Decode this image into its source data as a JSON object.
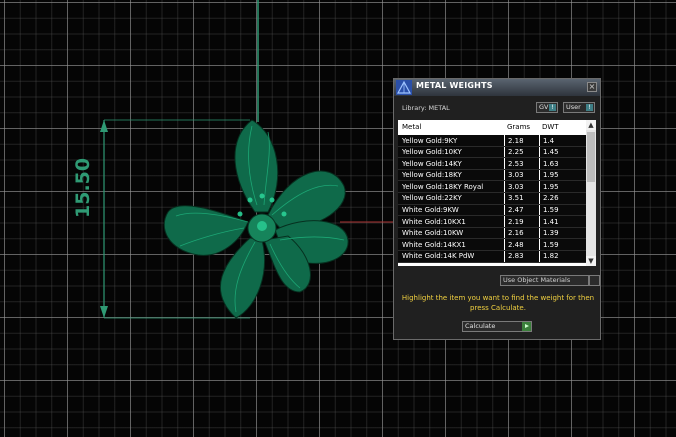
{
  "viewport": {
    "dimension_label": "15.50",
    "accent_color": "#2f9a74"
  },
  "panel": {
    "title": "METAL WEIGHTS",
    "close_glyph": "×",
    "library_label": "Library: METAL",
    "gv_label": "GV",
    "user_label": "User",
    "indicator_glyph": "!",
    "columns": [
      "Metal",
      "Grams",
      "DWT"
    ],
    "rows": [
      {
        "metal": "Yellow Gold:9KY",
        "grams": "2.18",
        "dwt": "1.4"
      },
      {
        "metal": "Yellow Gold:10KY",
        "grams": "2.25",
        "dwt": "1.45"
      },
      {
        "metal": "Yellow Gold:14KY",
        "grams": "2.53",
        "dwt": "1.63"
      },
      {
        "metal": "Yellow Gold:18KY",
        "grams": "3.03",
        "dwt": "1.95"
      },
      {
        "metal": "Yellow Gold:18KY Royal",
        "grams": "3.03",
        "dwt": "1.95"
      },
      {
        "metal": "Yellow Gold:22KY",
        "grams": "3.51",
        "dwt": "2.26"
      },
      {
        "metal": "White Gold:9KW",
        "grams": "2.47",
        "dwt": "1.59"
      },
      {
        "metal": "White Gold:10KX1",
        "grams": "2.19",
        "dwt": "1.41"
      },
      {
        "metal": "White Gold:10KW",
        "grams": "2.16",
        "dwt": "1.39"
      },
      {
        "metal": "White Gold:14KX1",
        "grams": "2.48",
        "dwt": "1.59"
      },
      {
        "metal": "White Gold:14K PdW",
        "grams": "2.83",
        "dwt": "1.82"
      }
    ],
    "use_object_materials": "Use Object Materials",
    "instruction": "Highlight the item you want to find the weight for then press Calculate.",
    "calculate_label": "Calculate"
  }
}
